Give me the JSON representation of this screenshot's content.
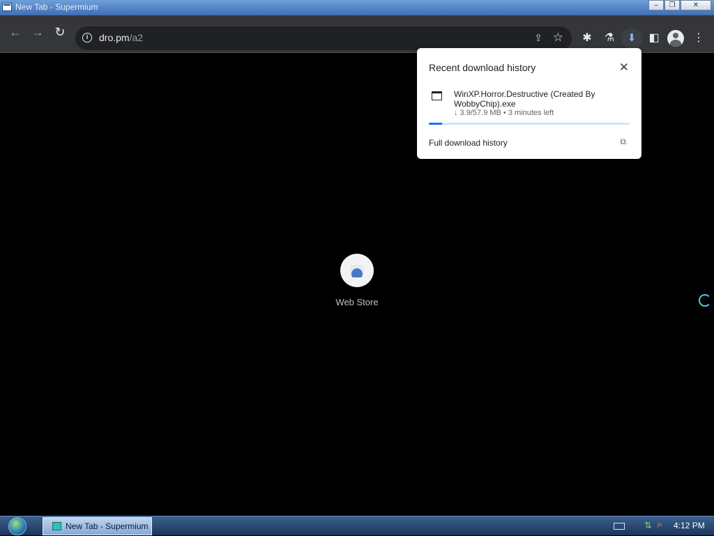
{
  "window": {
    "title": "New Tab - Supermium",
    "min_icon": "min-icon",
    "max_icon": "maximize-icon",
    "close_icon": "close-icon"
  },
  "toolbar": {
    "back_icon": "back-arrow-icon",
    "forward_icon": "forward-arrow-icon",
    "reload_icon": "reload-icon",
    "url_host": "dro.pm",
    "url_path": "/a2",
    "share_icon": "share-icon",
    "bookmark_icon": "star-icon",
    "extensions_icon": "puzzle-icon",
    "labs_icon": "flask-icon",
    "download_icon": "download-icon",
    "sidepanel_icon": "side-panel-icon",
    "profile_icon": "profile-icon",
    "menu_icon": "kebab-menu-icon"
  },
  "newtab": {
    "shortcut_label": "Web Store"
  },
  "download_popup": {
    "title": "Recent download history",
    "file_name": "WinXP.Horror.Destructive  (Created By WobbyChip).exe",
    "status": "↓ 3.9/57.9 MB • 3 minutes left",
    "progress_fraction": 0.0674,
    "footer_link": "Full download history",
    "accent": "#1a73e8"
  },
  "taskbar": {
    "task_label": "New Tab - Supermium",
    "clock": "4:12 PM"
  }
}
